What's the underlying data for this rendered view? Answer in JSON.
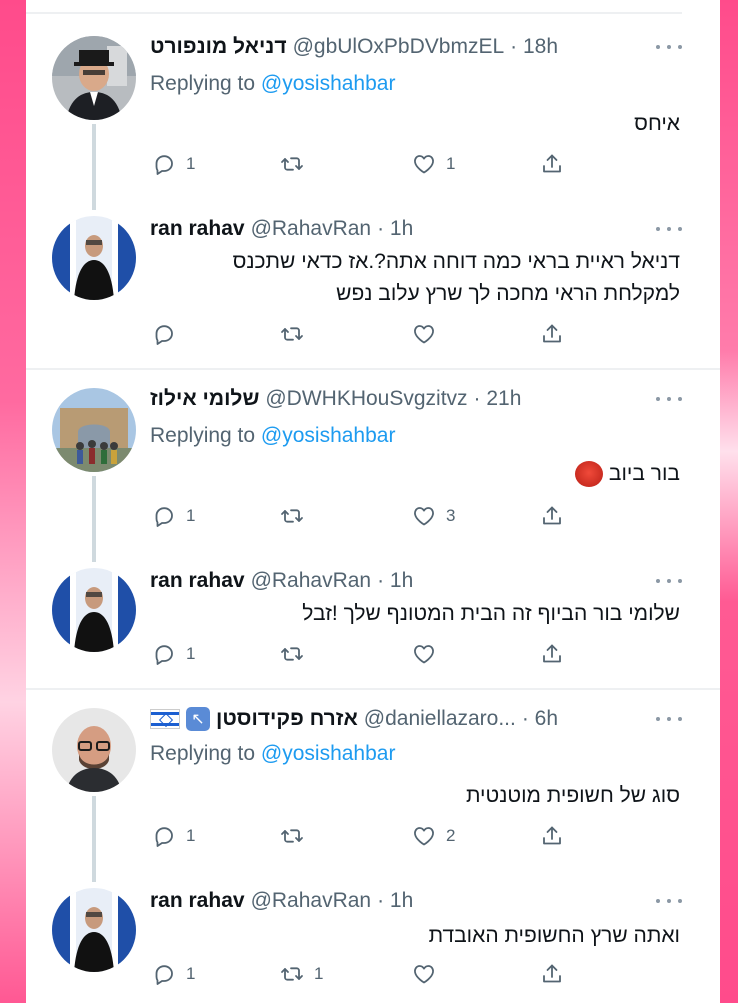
{
  "colors": {
    "accent": "#1d9bf0",
    "frame": "#fc4f8c"
  },
  "tweets": [
    {
      "name": "דניאל מונפורט",
      "handle": "@gbUlOxPbDVbmzEL",
      "time": "· 18h",
      "replying_label": "Replying to",
      "replying_handle": "@yosishahbar",
      "text": "איחס",
      "counts": {
        "reply": "1",
        "retweet": "",
        "like": "1"
      }
    },
    {
      "name": "ran rahav",
      "handle": "@RahavRan",
      "time": "· 1h",
      "text_lines": [
        "דניאל ראיית בראי כמה דוחה אתה?.אז כדאי שתכנס",
        "למקלחת הראי מחכה לך שרץ עלוב נפש"
      ],
      "counts": {
        "reply": "",
        "retweet": "",
        "like": ""
      }
    },
    {
      "name": "שלומי אילוז",
      "handle": "@DWHKHouSvgzitvz",
      "time": "· 21h",
      "replying_label": "Replying to",
      "replying_handle": "@yosishahbar",
      "text": "בור ביוב",
      "counts": {
        "reply": "1",
        "retweet": "",
        "like": "3"
      }
    },
    {
      "name": "ran rahav",
      "handle": "@RahavRan",
      "time": "· 1h",
      "text": "שלומי בור הביוף זה הבית המטונף שלך !זבל",
      "counts": {
        "reply": "1",
        "retweet": "",
        "like": ""
      }
    },
    {
      "name": "אזרח פקידוסטן",
      "handle": "@daniellazaro...",
      "time": "· 6h",
      "replying_label": "Replying to",
      "replying_handle": "@yosishahbar",
      "text": "סוג של חשופית מוטנטית",
      "counts": {
        "reply": "1",
        "retweet": "",
        "like": "2"
      }
    },
    {
      "name": "ran rahav",
      "handle": "@RahavRan",
      "time": "· 1h",
      "text": "ואתה שרץ החשופית האובדת",
      "counts": {
        "reply": "1",
        "retweet": "1",
        "like": ""
      }
    }
  ]
}
